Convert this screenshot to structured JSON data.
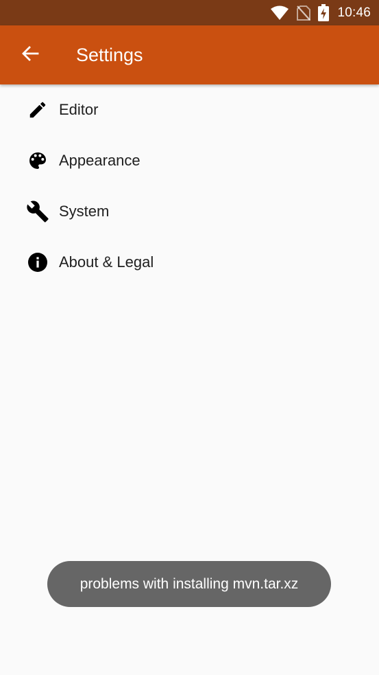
{
  "status_bar": {
    "time": "10:46",
    "icons": [
      "wifi-icon",
      "no-sim-icon",
      "battery-charging-icon"
    ],
    "background": "#7a3a16"
  },
  "app_bar": {
    "title": "Settings",
    "back_icon": "arrow-back-icon",
    "background": "#ca5010"
  },
  "settings": {
    "items": [
      {
        "label": "Editor",
        "icon": "pencil-icon"
      },
      {
        "label": "Appearance",
        "icon": "palette-icon"
      },
      {
        "label": "System",
        "icon": "wrench-icon"
      },
      {
        "label": "About & Legal",
        "icon": "info-icon"
      }
    ]
  },
  "toast": {
    "message": "problems with installing mvn.tar.xz",
    "background": "#666666"
  }
}
